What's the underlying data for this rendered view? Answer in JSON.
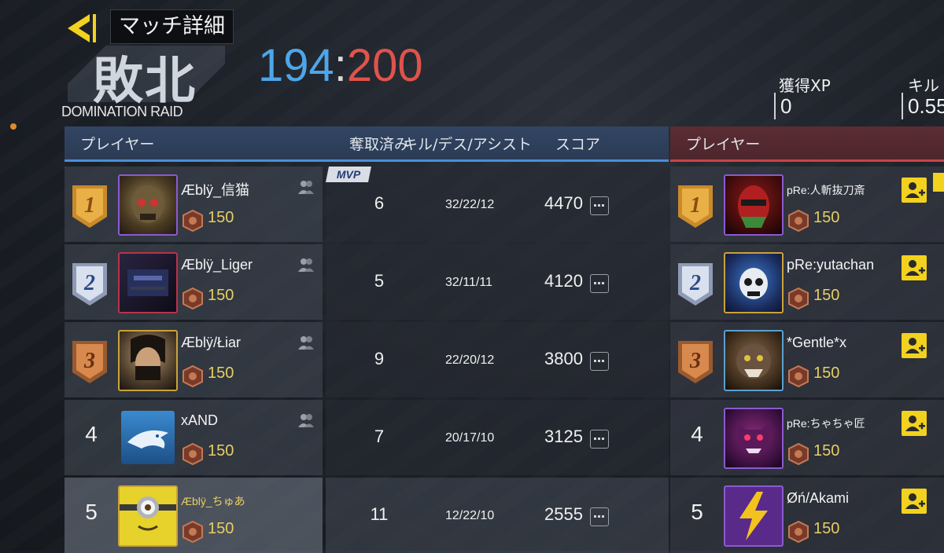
{
  "header": {
    "title": "マッチ詳細",
    "result": "敗北",
    "score_ours": "194",
    "score_sep": ":",
    "score_theirs": "200",
    "mode": "DOMINATION RAID",
    "stats": [
      {
        "label": "獲得XP",
        "value": "0"
      },
      {
        "label": "キル",
        "value": "0.55"
      }
    ]
  },
  "colors": {
    "blue_team": "#4ea6e8",
    "red_team": "#e0534b",
    "gold": "#e6cf63",
    "add_friend": "#f2d21e"
  },
  "table": {
    "left_header": {
      "player": "プレイヤー",
      "captures": "奪取済み",
      "kda": "キル/デス/アシスト",
      "score": "スコア"
    },
    "right_header": {
      "player": "プレイヤー"
    },
    "left_rows": [
      {
        "rank": "1",
        "name": "Æblÿ_信猫",
        "level": "150",
        "captures": "6",
        "kda": "32/22/12",
        "score": "4470",
        "mvp": "MVP",
        "avatar_icon": "skull-mask-avatar"
      },
      {
        "rank": "2",
        "name": "Æblÿ_Liger",
        "level": "150",
        "captures": "5",
        "kda": "32/11/11",
        "score": "4120",
        "avatar_icon": "dark-glitch-avatar"
      },
      {
        "rank": "3",
        "name": "Æblÿ/Łiar",
        "level": "150",
        "captures": "9",
        "kda": "22/20/12",
        "score": "3800",
        "avatar_icon": "masked-woman-avatar"
      },
      {
        "rank": "4",
        "name": "xAND",
        "level": "150",
        "captures": "7",
        "kda": "20/17/10",
        "score": "3125",
        "avatar_icon": "shark-avatar"
      },
      {
        "rank": "5",
        "name": "Æblÿ_ちゅあ",
        "level": "150",
        "captures": "11",
        "kda": "12/22/10",
        "score": "2555",
        "avatar_icon": "minion-avatar"
      }
    ],
    "right_rows": [
      {
        "rank": "1",
        "name": "pRe:人斬抜刀斎",
        "level": "150",
        "avatar_icon": "red-ninja-avatar"
      },
      {
        "rank": "2",
        "name": "pRe:yutachan",
        "level": "150",
        "avatar_icon": "blue-skull-avatar"
      },
      {
        "rank": "3",
        "name": "*Gentle*x",
        "level": "150",
        "avatar_icon": "beast-avatar"
      },
      {
        "rank": "4",
        "name": "pRe:ちゃちゃ匠",
        "level": "150",
        "avatar_icon": "purple-demon-avatar"
      },
      {
        "rank": "5",
        "name": "Øń/Akami",
        "level": "150",
        "avatar_icon": "lightning-avatar"
      }
    ]
  }
}
